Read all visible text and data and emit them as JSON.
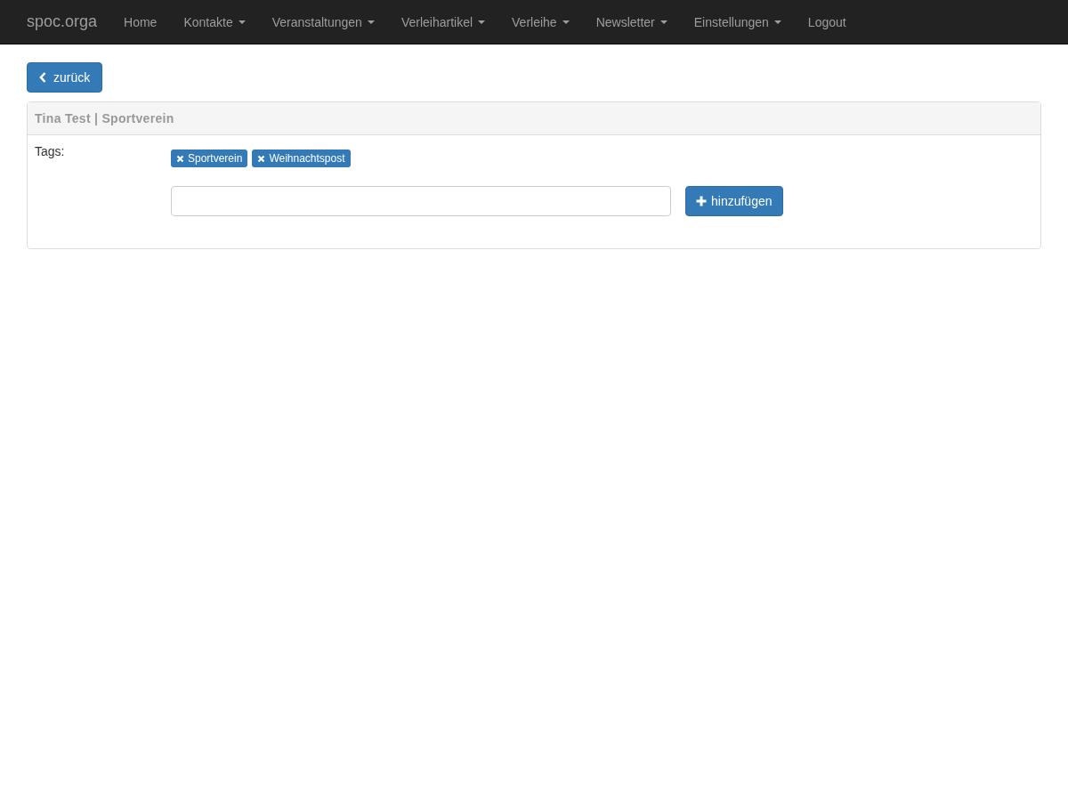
{
  "navbar": {
    "brand": "spoc.orga",
    "items": [
      {
        "label": "Home",
        "dropdown": false
      },
      {
        "label": "Kontakte",
        "dropdown": true
      },
      {
        "label": "Veranstaltungen",
        "dropdown": true
      },
      {
        "label": "Verleihartikel",
        "dropdown": true
      },
      {
        "label": "Verleihe",
        "dropdown": true
      },
      {
        "label": "Newsletter",
        "dropdown": true
      },
      {
        "label": "Einstellungen",
        "dropdown": true
      },
      {
        "label": "Logout",
        "dropdown": false
      }
    ]
  },
  "back_button": {
    "label": "zurück"
  },
  "panel": {
    "title": "Tina Test | Sportverein",
    "tags_label": "Tags:",
    "tags": [
      "Sportverein",
      "Weihnachtspost"
    ],
    "add_button": {
      "label": "hinzufügen"
    }
  }
}
